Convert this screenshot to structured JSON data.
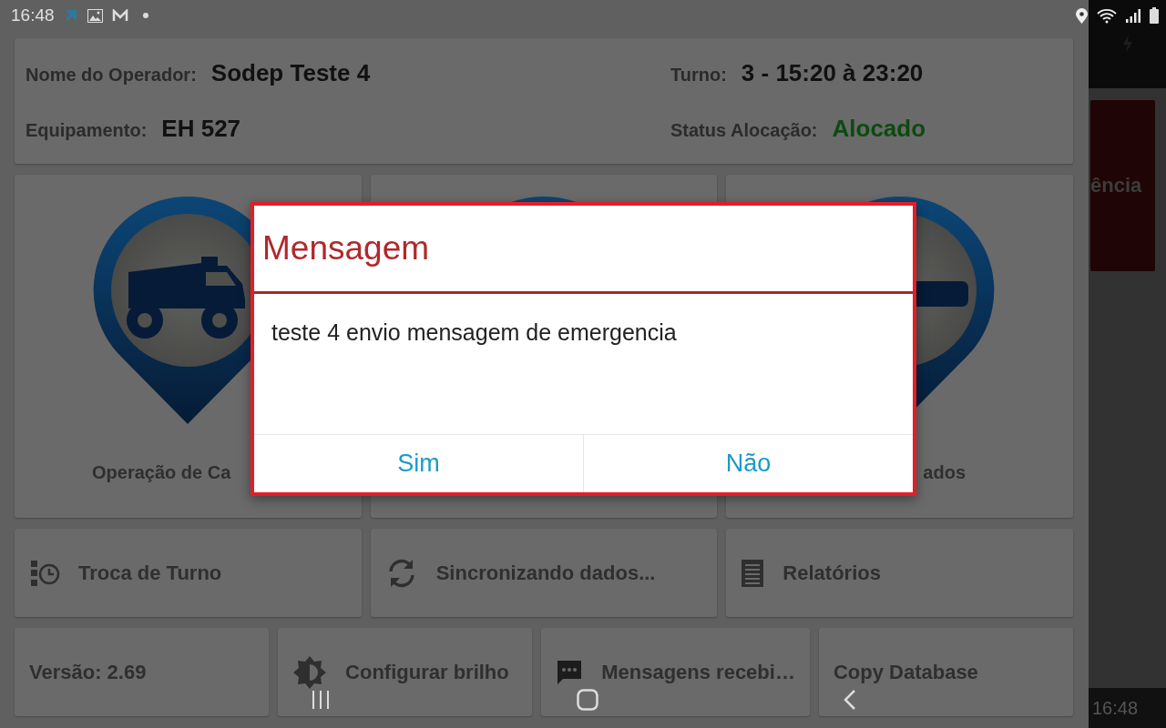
{
  "status_bar": {
    "time": "16:48"
  },
  "header": {
    "fields": [
      {
        "label": "Nome do Operador:",
        "value": "Sodep Teste 4",
        "kind": "plain"
      },
      {
        "label": "Turno:",
        "value": "3 - 15:20 à 23:20",
        "kind": "plain"
      },
      {
        "label": "Equipamento:",
        "value": "EH 527",
        "kind": "plain"
      },
      {
        "label": "Status Alocação:",
        "value": "Alocado",
        "kind": "status"
      }
    ]
  },
  "tiles": [
    {
      "kind": "truck",
      "label": "Operação de Ca"
    },
    {
      "kind": "pin"
    },
    {
      "kind": "bar",
      "label": "ados"
    }
  ],
  "actions": [
    {
      "kind": "clock",
      "label": "Troca de Turno"
    },
    {
      "kind": "sync",
      "label": "Sincronizando dados..."
    },
    {
      "kind": "report",
      "label": "Relatórios"
    }
  ],
  "footer": [
    {
      "kind": "text",
      "label": "Versão:  2.69"
    },
    {
      "kind": "brightness",
      "label": "Configurar brilho"
    },
    {
      "kind": "chat",
      "label": "Mensagens recebi…"
    },
    {
      "kind": "text",
      "label": "Copy Database"
    }
  ],
  "side_panel": {
    "emergency_label": "ência",
    "time": "16:48"
  },
  "dialog": {
    "title": "Mensagem",
    "message": "teste 4 envio mensagem de emergencia",
    "buttons": [
      "Sim",
      "Não"
    ]
  }
}
